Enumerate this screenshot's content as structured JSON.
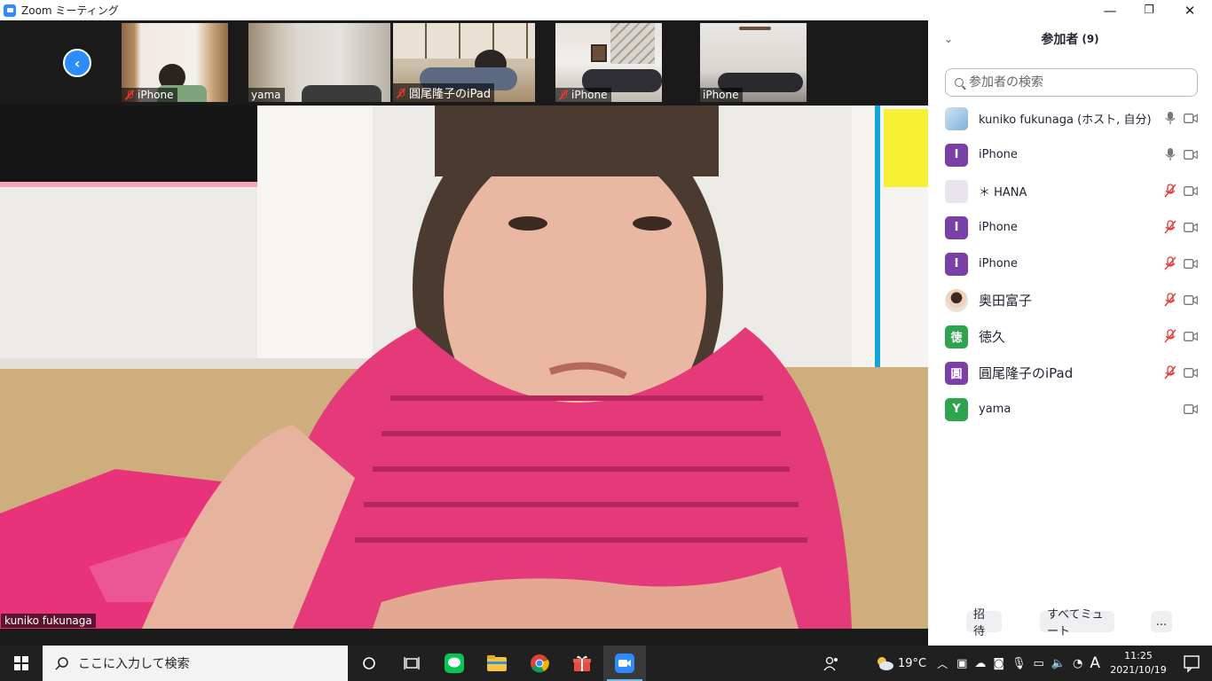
{
  "window": {
    "title": "Zoom ミーティング",
    "minimize": "—",
    "maximize": "❐",
    "close": "✕"
  },
  "strip": {
    "prev_symbol": "‹",
    "thumbnails": [
      {
        "name": "iPhone",
        "muted": true
      },
      {
        "name": "yama",
        "muted": false
      },
      {
        "name": "圓尾隆子のiPad",
        "muted": true
      },
      {
        "name": "iPhone",
        "muted": true
      },
      {
        "name": "iPhone",
        "muted": false
      }
    ]
  },
  "main": {
    "speaker_name": "kuniko fukunaga"
  },
  "panel": {
    "title": "参加者",
    "count": "(9)",
    "collapse_symbol": "⌄",
    "search_placeholder": "参加者の検索",
    "participants": [
      {
        "name": "kuniko fukunaga (ホスト, 自分)",
        "avatar": "",
        "avatar_color": "#9ec5e6",
        "mic": "on"
      },
      {
        "name": "iPhone",
        "avatar": "I",
        "avatar_color": "#7b3fa8",
        "mic": "on"
      },
      {
        "name": "＊ HANA",
        "avatar": "",
        "avatar_color": "#e9e4ee",
        "mic": "muted"
      },
      {
        "name": "iPhone",
        "avatar": "I",
        "avatar_color": "#7b3fa8",
        "mic": "muted"
      },
      {
        "name": "iPhone",
        "avatar": "I",
        "avatar_color": "#7b3fa8",
        "mic": "muted"
      },
      {
        "name": "奥田富子",
        "avatar": "",
        "avatar_color": "#d8b79c",
        "mic": "muted"
      },
      {
        "name": "徳久",
        "avatar": "徳",
        "avatar_color": "#2ea44f",
        "mic": "muted"
      },
      {
        "name": "圓尾隆子のiPad",
        "avatar": "圓",
        "avatar_color": "#7b3fa8",
        "mic": "muted"
      },
      {
        "name": "yama",
        "avatar": "Y",
        "avatar_color": "#2ea44f",
        "mic": "none"
      }
    ],
    "invite_label": "招待",
    "mute_all_label": "すべてミュート",
    "more_label": "..."
  },
  "taskbar": {
    "search_placeholder": "ここに入力して検索",
    "apps": [
      "cortana-icon",
      "task-view-icon",
      "line-app-icon",
      "file-explorer-icon",
      "chrome-icon",
      "gift-icon",
      "zoom-app-icon"
    ],
    "temperature": "19°C",
    "ime": "A",
    "time": "11:25",
    "date": "2021/10/19"
  },
  "colors": {
    "accent": "#2d8cff",
    "muted_red": "#e53935",
    "taskbar": "#202020"
  }
}
